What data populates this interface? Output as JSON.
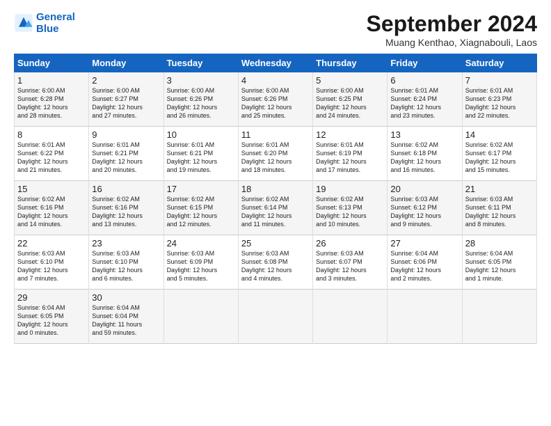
{
  "header": {
    "logo_line1": "General",
    "logo_line2": "Blue",
    "month": "September 2024",
    "location": "Muang Kenthao, Xiagnabouli, Laos"
  },
  "columns": [
    "Sunday",
    "Monday",
    "Tuesday",
    "Wednesday",
    "Thursday",
    "Friday",
    "Saturday"
  ],
  "weeks": [
    [
      {
        "day": "1",
        "lines": [
          "Sunrise: 6:00 AM",
          "Sunset: 6:28 PM",
          "Daylight: 12 hours",
          "and 28 minutes."
        ]
      },
      {
        "day": "2",
        "lines": [
          "Sunrise: 6:00 AM",
          "Sunset: 6:27 PM",
          "Daylight: 12 hours",
          "and 27 minutes."
        ]
      },
      {
        "day": "3",
        "lines": [
          "Sunrise: 6:00 AM",
          "Sunset: 6:26 PM",
          "Daylight: 12 hours",
          "and 26 minutes."
        ]
      },
      {
        "day": "4",
        "lines": [
          "Sunrise: 6:00 AM",
          "Sunset: 6:26 PM",
          "Daylight: 12 hours",
          "and 25 minutes."
        ]
      },
      {
        "day": "5",
        "lines": [
          "Sunrise: 6:00 AM",
          "Sunset: 6:25 PM",
          "Daylight: 12 hours",
          "and 24 minutes."
        ]
      },
      {
        "day": "6",
        "lines": [
          "Sunrise: 6:01 AM",
          "Sunset: 6:24 PM",
          "Daylight: 12 hours",
          "and 23 minutes."
        ]
      },
      {
        "day": "7",
        "lines": [
          "Sunrise: 6:01 AM",
          "Sunset: 6:23 PM",
          "Daylight: 12 hours",
          "and 22 minutes."
        ]
      }
    ],
    [
      {
        "day": "8",
        "lines": [
          "Sunrise: 6:01 AM",
          "Sunset: 6:22 PM",
          "Daylight: 12 hours",
          "and 21 minutes."
        ]
      },
      {
        "day": "9",
        "lines": [
          "Sunrise: 6:01 AM",
          "Sunset: 6:21 PM",
          "Daylight: 12 hours",
          "and 20 minutes."
        ]
      },
      {
        "day": "10",
        "lines": [
          "Sunrise: 6:01 AM",
          "Sunset: 6:21 PM",
          "Daylight: 12 hours",
          "and 19 minutes."
        ]
      },
      {
        "day": "11",
        "lines": [
          "Sunrise: 6:01 AM",
          "Sunset: 6:20 PM",
          "Daylight: 12 hours",
          "and 18 minutes."
        ]
      },
      {
        "day": "12",
        "lines": [
          "Sunrise: 6:01 AM",
          "Sunset: 6:19 PM",
          "Daylight: 12 hours",
          "and 17 minutes."
        ]
      },
      {
        "day": "13",
        "lines": [
          "Sunrise: 6:02 AM",
          "Sunset: 6:18 PM",
          "Daylight: 12 hours",
          "and 16 minutes."
        ]
      },
      {
        "day": "14",
        "lines": [
          "Sunrise: 6:02 AM",
          "Sunset: 6:17 PM",
          "Daylight: 12 hours",
          "and 15 minutes."
        ]
      }
    ],
    [
      {
        "day": "15",
        "lines": [
          "Sunrise: 6:02 AM",
          "Sunset: 6:16 PM",
          "Daylight: 12 hours",
          "and 14 minutes."
        ]
      },
      {
        "day": "16",
        "lines": [
          "Sunrise: 6:02 AM",
          "Sunset: 6:16 PM",
          "Daylight: 12 hours",
          "and 13 minutes."
        ]
      },
      {
        "day": "17",
        "lines": [
          "Sunrise: 6:02 AM",
          "Sunset: 6:15 PM",
          "Daylight: 12 hours",
          "and 12 minutes."
        ]
      },
      {
        "day": "18",
        "lines": [
          "Sunrise: 6:02 AM",
          "Sunset: 6:14 PM",
          "Daylight: 12 hours",
          "and 11 minutes."
        ]
      },
      {
        "day": "19",
        "lines": [
          "Sunrise: 6:02 AM",
          "Sunset: 6:13 PM",
          "Daylight: 12 hours",
          "and 10 minutes."
        ]
      },
      {
        "day": "20",
        "lines": [
          "Sunrise: 6:03 AM",
          "Sunset: 6:12 PM",
          "Daylight: 12 hours",
          "and 9 minutes."
        ]
      },
      {
        "day": "21",
        "lines": [
          "Sunrise: 6:03 AM",
          "Sunset: 6:11 PM",
          "Daylight: 12 hours",
          "and 8 minutes."
        ]
      }
    ],
    [
      {
        "day": "22",
        "lines": [
          "Sunrise: 6:03 AM",
          "Sunset: 6:10 PM",
          "Daylight: 12 hours",
          "and 7 minutes."
        ]
      },
      {
        "day": "23",
        "lines": [
          "Sunrise: 6:03 AM",
          "Sunset: 6:10 PM",
          "Daylight: 12 hours",
          "and 6 minutes."
        ]
      },
      {
        "day": "24",
        "lines": [
          "Sunrise: 6:03 AM",
          "Sunset: 6:09 PM",
          "Daylight: 12 hours",
          "and 5 minutes."
        ]
      },
      {
        "day": "25",
        "lines": [
          "Sunrise: 6:03 AM",
          "Sunset: 6:08 PM",
          "Daylight: 12 hours",
          "and 4 minutes."
        ]
      },
      {
        "day": "26",
        "lines": [
          "Sunrise: 6:03 AM",
          "Sunset: 6:07 PM",
          "Daylight: 12 hours",
          "and 3 minutes."
        ]
      },
      {
        "day": "27",
        "lines": [
          "Sunrise: 6:04 AM",
          "Sunset: 6:06 PM",
          "Daylight: 12 hours",
          "and 2 minutes."
        ]
      },
      {
        "day": "28",
        "lines": [
          "Sunrise: 6:04 AM",
          "Sunset: 6:05 PM",
          "Daylight: 12 hours",
          "and 1 minute."
        ]
      }
    ],
    [
      {
        "day": "29",
        "lines": [
          "Sunrise: 6:04 AM",
          "Sunset: 6:05 PM",
          "Daylight: 12 hours",
          "and 0 minutes."
        ]
      },
      {
        "day": "30",
        "lines": [
          "Sunrise: 6:04 AM",
          "Sunset: 6:04 PM",
          "Daylight: 11 hours",
          "and 59 minutes."
        ]
      },
      {
        "day": "",
        "lines": []
      },
      {
        "day": "",
        "lines": []
      },
      {
        "day": "",
        "lines": []
      },
      {
        "day": "",
        "lines": []
      },
      {
        "day": "",
        "lines": []
      }
    ]
  ]
}
